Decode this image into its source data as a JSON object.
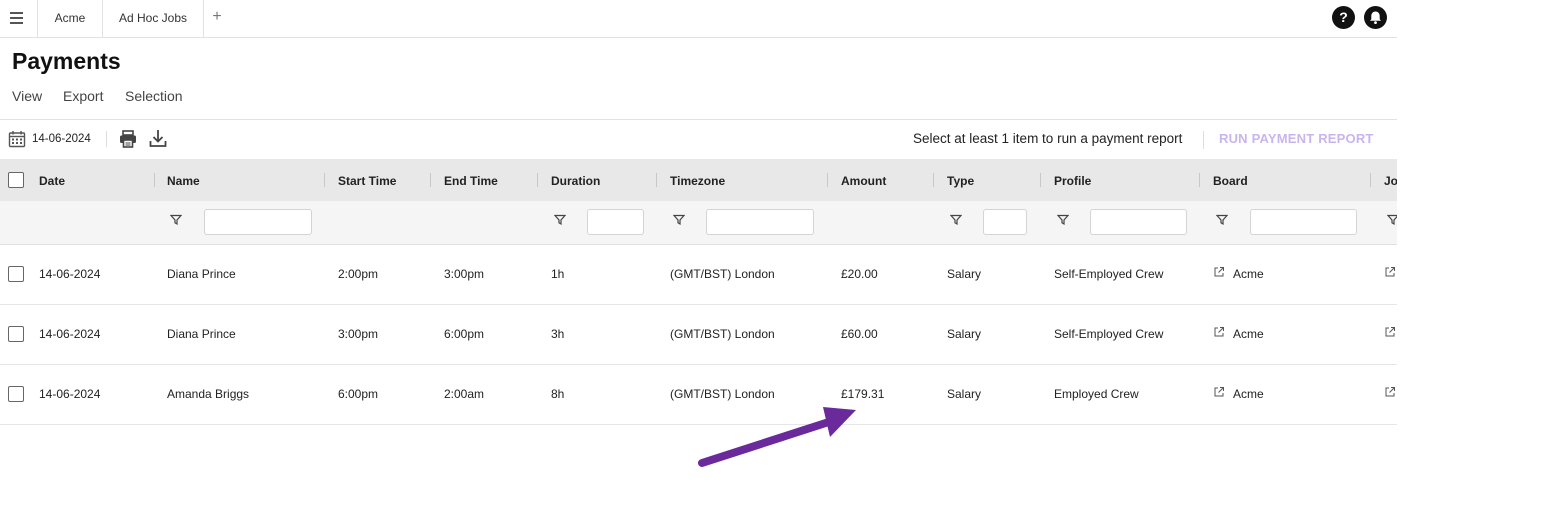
{
  "tabs": {
    "acme": "Acme",
    "adhoc": "Ad Hoc Jobs",
    "add": "+"
  },
  "header": {
    "help_icon": "question-icon",
    "notification_icon": "bell-icon"
  },
  "page": {
    "title": "Payments",
    "menu": {
      "view": "View",
      "export": "Export",
      "selection": "Selection"
    }
  },
  "toolbar": {
    "date": "14-06-2024",
    "report_hint": "Select at least 1 item to run a payment report",
    "run_report": "RUN PAYMENT REPORT"
  },
  "table": {
    "columns": {
      "date": "Date",
      "name": "Name",
      "start_time": "Start Time",
      "end_time": "End Time",
      "duration": "Duration",
      "timezone": "Timezone",
      "amount": "Amount",
      "type": "Type",
      "profile": "Profile",
      "board": "Board",
      "job": "Jo"
    },
    "rows": [
      {
        "date": "14-06-2024",
        "name": "Diana Prince",
        "start_time": "2:00pm",
        "end_time": "3:00pm",
        "duration": "1h",
        "timezone": "(GMT/BST) London",
        "amount": "£20.00",
        "type": "Salary",
        "profile": "Self-Employed Crew",
        "board": "Acme"
      },
      {
        "date": "14-06-2024",
        "name": "Diana Prince",
        "start_time": "3:00pm",
        "end_time": "6:00pm",
        "duration": "3h",
        "timezone": "(GMT/BST) London",
        "amount": "£60.00",
        "type": "Salary",
        "profile": "Self-Employed Crew",
        "board": "Acme"
      },
      {
        "date": "14-06-2024",
        "name": "Amanda Briggs",
        "start_time": "6:00pm",
        "end_time": "2:00am",
        "duration": "8h",
        "timezone": "(GMT/BST) London",
        "amount": "£179.31",
        "type": "Salary",
        "profile": "Employed Crew",
        "board": "Acme"
      }
    ]
  },
  "colors": {
    "accent_light": "#c9b5ee",
    "annotation_arrow": "#6b2a9c",
    "header_bg": "#e8e8e8"
  }
}
